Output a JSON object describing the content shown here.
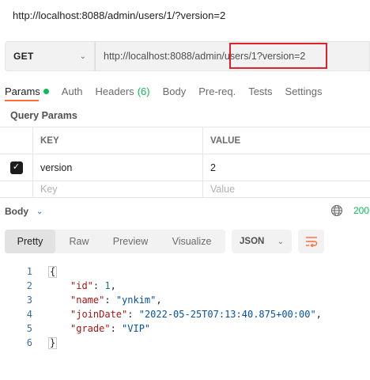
{
  "request": {
    "title": "http://localhost:8088/admin/users/1/?version=2"
  },
  "url_bar": {
    "method": "GET",
    "url": "http://localhost:8088/admin/users/1?version=2"
  },
  "tabs": [
    {
      "label": "Params"
    },
    {
      "label": "Auth"
    },
    {
      "label": "Headers",
      "count": "(6)"
    },
    {
      "label": "Body"
    },
    {
      "label": "Pre-req."
    },
    {
      "label": "Tests"
    },
    {
      "label": "Settings"
    }
  ],
  "query_params": {
    "label": "Query Params",
    "headers": {
      "key": "KEY",
      "value": "VALUE"
    },
    "rows": [
      {
        "key": "version",
        "value": "2",
        "checked": true
      }
    ],
    "placeholder": {
      "key": "Key",
      "value": "Value"
    }
  },
  "response": {
    "body_label": "Body",
    "status": "200",
    "view_tabs": [
      "Pretty",
      "Raw",
      "Preview",
      "Visualize"
    ],
    "format": "JSON",
    "line_numbers": [
      "1",
      "2",
      "3",
      "4",
      "5",
      "6"
    ],
    "json": {
      "open": "{",
      "close": "}",
      "id_key": "\"id\"",
      "id_val": "1",
      "name_key": "\"name\"",
      "name_val": "\"ynkim\"",
      "join_key": "\"joinDate\"",
      "join_val": "\"2022-05-25T07:13:40.875+00:00\"",
      "grade_key": "\"grade\"",
      "grade_val": "\"VIP\""
    }
  },
  "colors": {
    "accent": "#ff6c37",
    "success": "#0cbb52",
    "highlight": "#e0202a"
  }
}
